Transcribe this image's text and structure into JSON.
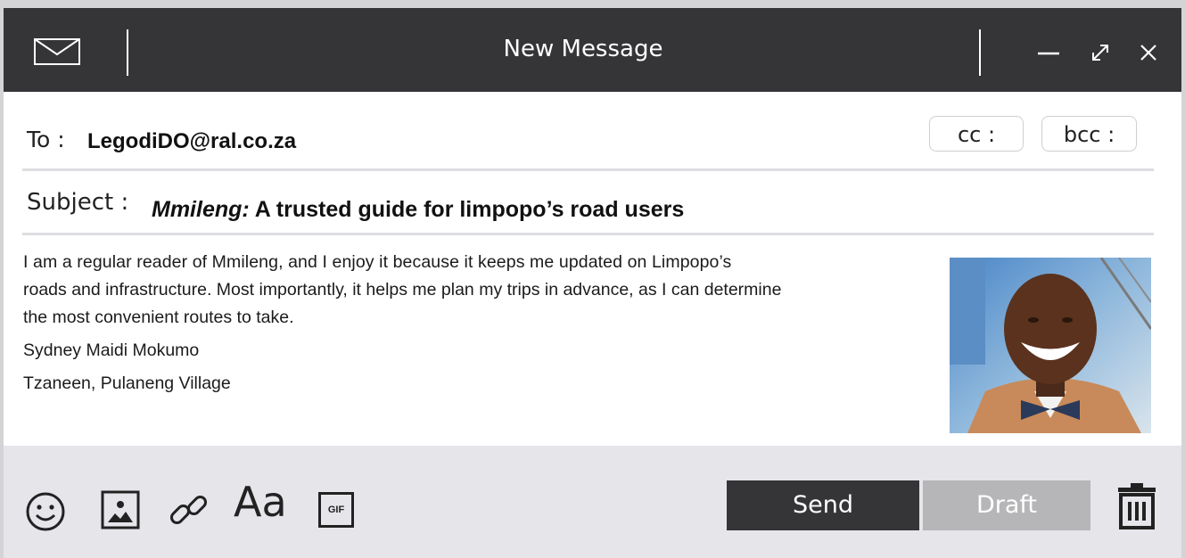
{
  "window": {
    "title": "New Message",
    "colors": {
      "titlebar": "#353538",
      "footer": "#e5e5ea",
      "send": "#353538",
      "draft": "#b6b6b8"
    }
  },
  "compose": {
    "to_label": "To :",
    "to_value": "LegodiDO@ral.co.za",
    "cc_label": "cc :",
    "bcc_label": "bcc :",
    "subject_label": "Subject :",
    "subject_italic": "Mmileng:",
    "subject_rest": " A trusted guide for limpopo’s road users"
  },
  "message": {
    "paragraph_line1": "I am a regular reader of Mmileng, and I enjoy it because it keeps me updated on Limpopo’s",
    "paragraph_line2": "roads and infrastructure. Most importantly, it helps me plan my trips in advance, as I can determine",
    "paragraph_line3": "the most convenient routes to take.",
    "signature_name": "Sydney Maidi Mokumo",
    "signature_location": "Tzaneen, Pulaneng Village"
  },
  "toolbar": {
    "font_label": "Aa",
    "gif_label": "GIF",
    "send_label": "Send",
    "draft_label": "Draft",
    "icons": [
      "emoji-icon",
      "image-icon",
      "link-icon",
      "font-icon",
      "gif-icon",
      "trash-icon"
    ]
  }
}
